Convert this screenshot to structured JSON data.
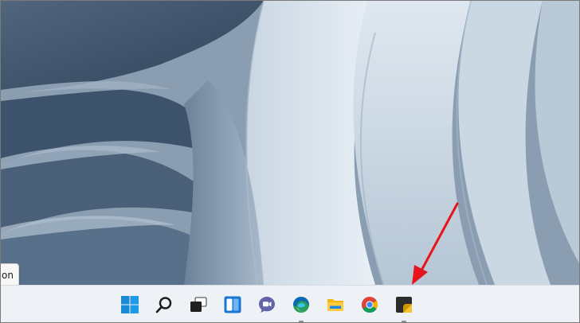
{
  "wallpaper": {
    "colors": {
      "sky": "#98a9bb",
      "petal_light": "#dbe5ee",
      "petal_shadow": "#4d627a"
    }
  },
  "tooltip": {
    "text": "on"
  },
  "taskbar": {
    "background": "#eef2f7",
    "icons": [
      {
        "icon": "windows-start-icon",
        "running": false
      },
      {
        "icon": "search-icon",
        "running": false
      },
      {
        "icon": "task-view-icon",
        "running": false
      },
      {
        "icon": "widgets-icon",
        "running": false
      },
      {
        "icon": "teams-chat-icon",
        "running": false
      },
      {
        "icon": "edge-icon",
        "running": true
      },
      {
        "icon": "file-explorer-icon",
        "running": false
      },
      {
        "icon": "chrome-icon",
        "running": false
      },
      {
        "icon": "sticky-notes-icon",
        "running": true
      }
    ]
  },
  "annotation": {
    "arrow_color": "#e8141c",
    "points_to": "sticky-notes-icon"
  }
}
